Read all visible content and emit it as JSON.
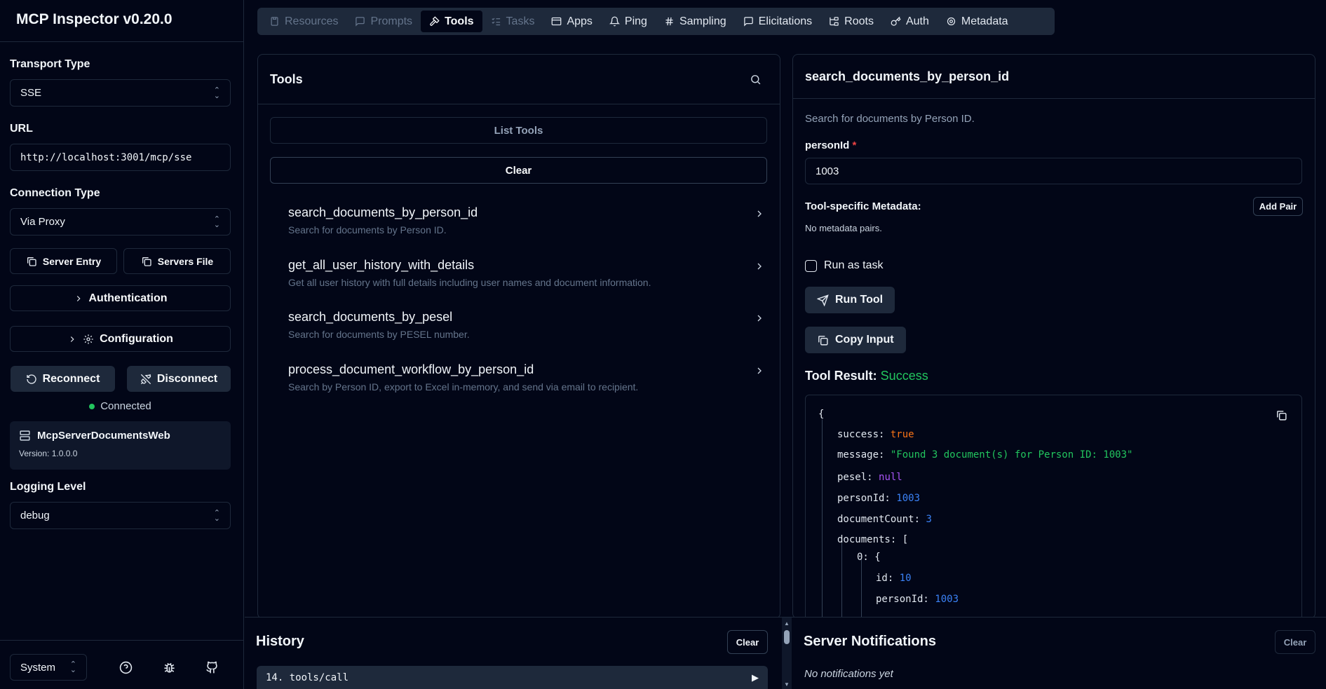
{
  "app": {
    "title": "MCP Inspector v0.20.0"
  },
  "sidebar": {
    "transport_label": "Transport Type",
    "transport_value": "SSE",
    "url_label": "URL",
    "url_value": "http://localhost:3001/mcp/sse",
    "connection_label": "Connection Type",
    "connection_value": "Via Proxy",
    "server_entry": "Server Entry",
    "servers_file": "Servers File",
    "authentication": "Authentication",
    "configuration": "Configuration",
    "reconnect": "Reconnect",
    "disconnect": "Disconnect",
    "status": "Connected",
    "server_name": "McpServerDocumentsWeb",
    "server_version": "Version: 1.0.0.0",
    "logging_label": "Logging Level",
    "logging_value": "debug",
    "theme_value": "System"
  },
  "tabs": [
    {
      "label": "Resources",
      "icon": "file-icon",
      "state": "disabled"
    },
    {
      "label": "Prompts",
      "icon": "message-icon",
      "state": "disabled"
    },
    {
      "label": "Tools",
      "icon": "hammer-icon",
      "state": "active"
    },
    {
      "label": "Tasks",
      "icon": "list-check-icon",
      "state": "disabled"
    },
    {
      "label": "Apps",
      "icon": "app-window-icon",
      "state": "normal"
    },
    {
      "label": "Ping",
      "icon": "bell-icon",
      "state": "normal"
    },
    {
      "label": "Sampling",
      "icon": "hash-icon",
      "state": "normal"
    },
    {
      "label": "Elicitations",
      "icon": "message-square-icon",
      "state": "normal"
    },
    {
      "label": "Roots",
      "icon": "folder-tree-icon",
      "state": "normal"
    },
    {
      "label": "Auth",
      "icon": "key-icon",
      "state": "normal"
    },
    {
      "label": "Metadata",
      "icon": "gear-icon",
      "state": "normal"
    }
  ],
  "tools_panel": {
    "title": "Tools",
    "list_tools": "List Tools",
    "clear": "Clear",
    "items": [
      {
        "name": "search_documents_by_person_id",
        "description": "Search for documents by Person ID."
      },
      {
        "name": "get_all_user_history_with_details",
        "description": "Get all user history with full details including user names and document information."
      },
      {
        "name": "search_documents_by_pesel",
        "description": "Search for documents by PESEL number."
      },
      {
        "name": "process_document_workflow_by_person_id",
        "description": "Search by Person ID, export to Excel in-memory, and send via email to recipient."
      }
    ]
  },
  "detail_panel": {
    "title": "search_documents_by_person_id",
    "description": "Search for documents by Person ID.",
    "param_label": "personId",
    "param_required": "*",
    "param_value": "1003",
    "metadata_label": "Tool-specific Metadata:",
    "add_pair": "Add Pair",
    "no_metadata": "No metadata pairs.",
    "run_as_task": "Run as task",
    "run_tool": "Run Tool",
    "copy_input": "Copy Input",
    "result_label": "Tool Result:",
    "result_status": "Success",
    "json": {
      "open": "{",
      "success_key": "success:",
      "success_val": "true",
      "message_key": "message:",
      "message_val": "\"Found 3 document(s) for Person ID: 1003\"",
      "pesel_key": "pesel:",
      "pesel_val": "null",
      "personId_key": "personId:",
      "personId_val": "1003",
      "documentCount_key": "documentCount:",
      "documentCount_val": "3",
      "documents_key": "documents:",
      "documents_open": "[",
      "item0_key": "0:",
      "item0_open": "{",
      "id_key": "id:",
      "id_val": "10",
      "inner_personId_key": "personId:",
      "inner_personId_val": "1003"
    }
  },
  "history": {
    "title": "History",
    "clear": "Clear",
    "entry": "14. tools/call"
  },
  "notifications": {
    "title": "Server Notifications",
    "clear": "Clear",
    "empty": "No notifications yet"
  }
}
